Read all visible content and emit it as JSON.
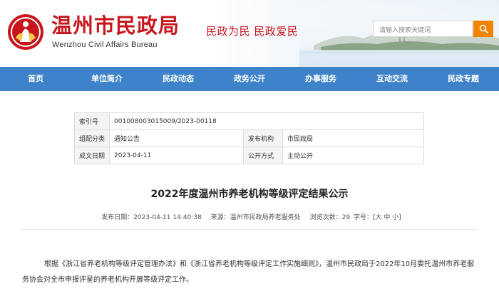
{
  "header": {
    "site_title": "温州市民政局",
    "site_subtitle": "Wenzhou Civil Affairs Bureau",
    "slogan": "民政为民  民政爱民",
    "search_placeholder": "请输入搜索关键词",
    "colors": {
      "brand_red": "#c8161d",
      "nav_blue": "#3e83c9",
      "search_orange": "#f08300"
    }
  },
  "nav": {
    "items": [
      {
        "label": "首页"
      },
      {
        "label": "单位简介"
      },
      {
        "label": "民政动态"
      },
      {
        "label": "政务公开"
      },
      {
        "label": "办事服务"
      },
      {
        "label": "互动交流"
      },
      {
        "label": "民政专题"
      }
    ]
  },
  "info": {
    "index_label": "索引号",
    "index_value": "001008003015009/2023-00118",
    "category_label": "组配分类",
    "category_value": "通知公告",
    "publisher_label": "发布机构",
    "publisher_value": "市民政局",
    "date_label": "成文日期",
    "date_value": "2023-04-11",
    "disclosure_label": "公开方式",
    "disclosure_value": "主动公开"
  },
  "article": {
    "title": "2022年度温州市养老机构等级评定结果公示",
    "publish_date": "发布日期：2023-04-11 14:40:38",
    "source": "来源：温州市民政局养老服务处",
    "views": "浏览次数：29",
    "font_size_label": "字号：",
    "font_size_options": "[大 中 小]",
    "paragraph": "根据《浙江省养老机构等级评定管理办法》和《浙江省养老机构等级评定工作实施细则》，温州市民政局于2022年10月委托温州市养老服务协会对全市申报评星的养老机构开展等级评定工作。"
  }
}
